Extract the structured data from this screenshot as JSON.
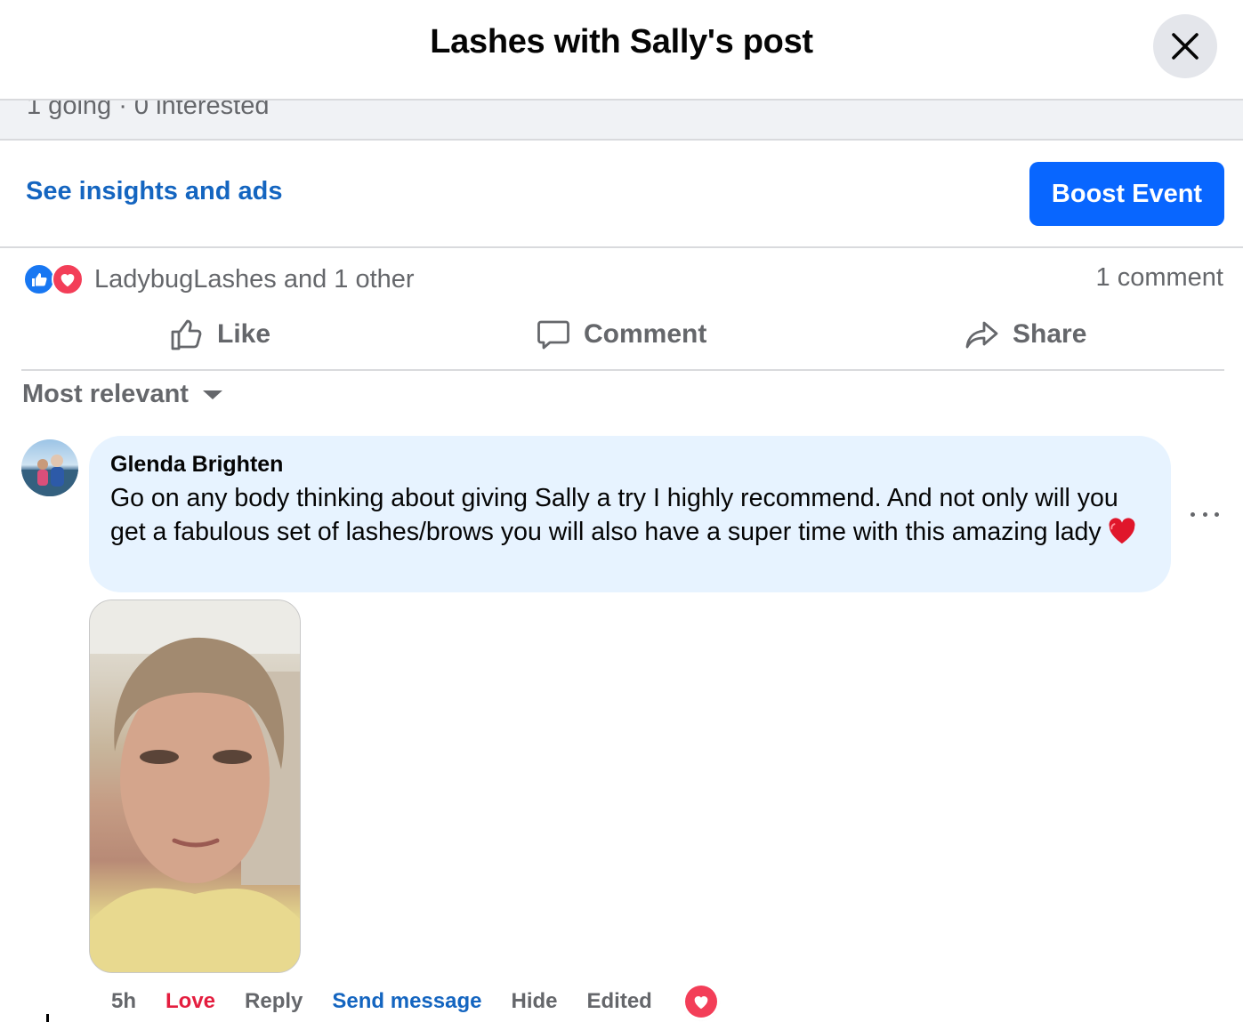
{
  "header": {
    "title": "Lashes with Sally's post",
    "close_icon": "close-icon"
  },
  "event": {
    "going_interested": "1 going · 0 interested"
  },
  "actions_bar": {
    "insights_label": "See insights and ads",
    "boost_label": "Boost Event"
  },
  "reactions": {
    "summary": "LadybugLashes and 1 other",
    "comment_count": "1 comment",
    "icons": [
      "like-icon",
      "love-icon"
    ]
  },
  "post_actions": {
    "like": "Like",
    "comment": "Comment",
    "share": "Share"
  },
  "sort": {
    "label": "Most relevant"
  },
  "comment": {
    "author": "Glenda Brighten",
    "text": "Go on any body thinking about giving Sally a try I highly recommend. And not only will you get a fabulous set of lashes/brows you will also have a super time with this amazing lady",
    "emoji": "red-heart",
    "footer": {
      "time": "5h",
      "love": "Love",
      "reply": "Reply",
      "send_message": "Send message",
      "hide": "Hide",
      "edited": "Edited"
    }
  },
  "colors": {
    "primary_blue": "#0866ff",
    "link_blue": "#1465c0",
    "love_red": "#e41e3f",
    "bubble_bg": "#e7f3ff",
    "secondary_text": "#65676b"
  }
}
